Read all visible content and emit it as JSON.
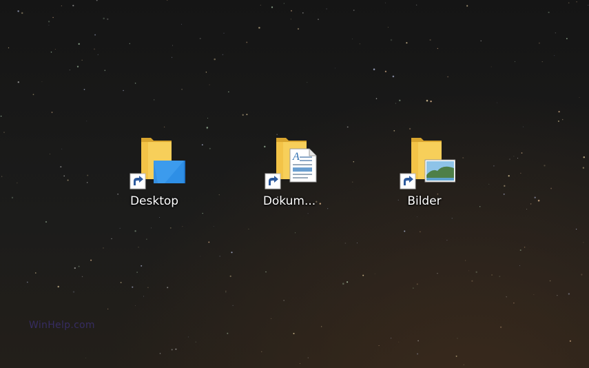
{
  "desktop": {
    "icons": [
      {
        "label": "Desktop",
        "type": "folder-shortcut",
        "overlay": "desktop-screen-icon"
      },
      {
        "label": "Dokum...",
        "type": "folder-shortcut",
        "overlay": "document-page-icon"
      },
      {
        "label": "Bilder",
        "type": "folder-shortcut",
        "overlay": "landscape-picture-icon"
      }
    ],
    "watermark": "WinHelp.com"
  },
  "colors": {
    "folder_yellow": "#f5c84c",
    "folder_dark": "#d9a52e",
    "screen_blue": "#2e8fe6",
    "shortcut_arrow": "#2c5a9e",
    "label_text": "#ffffff",
    "watermark_text": "#3a2f6e"
  }
}
